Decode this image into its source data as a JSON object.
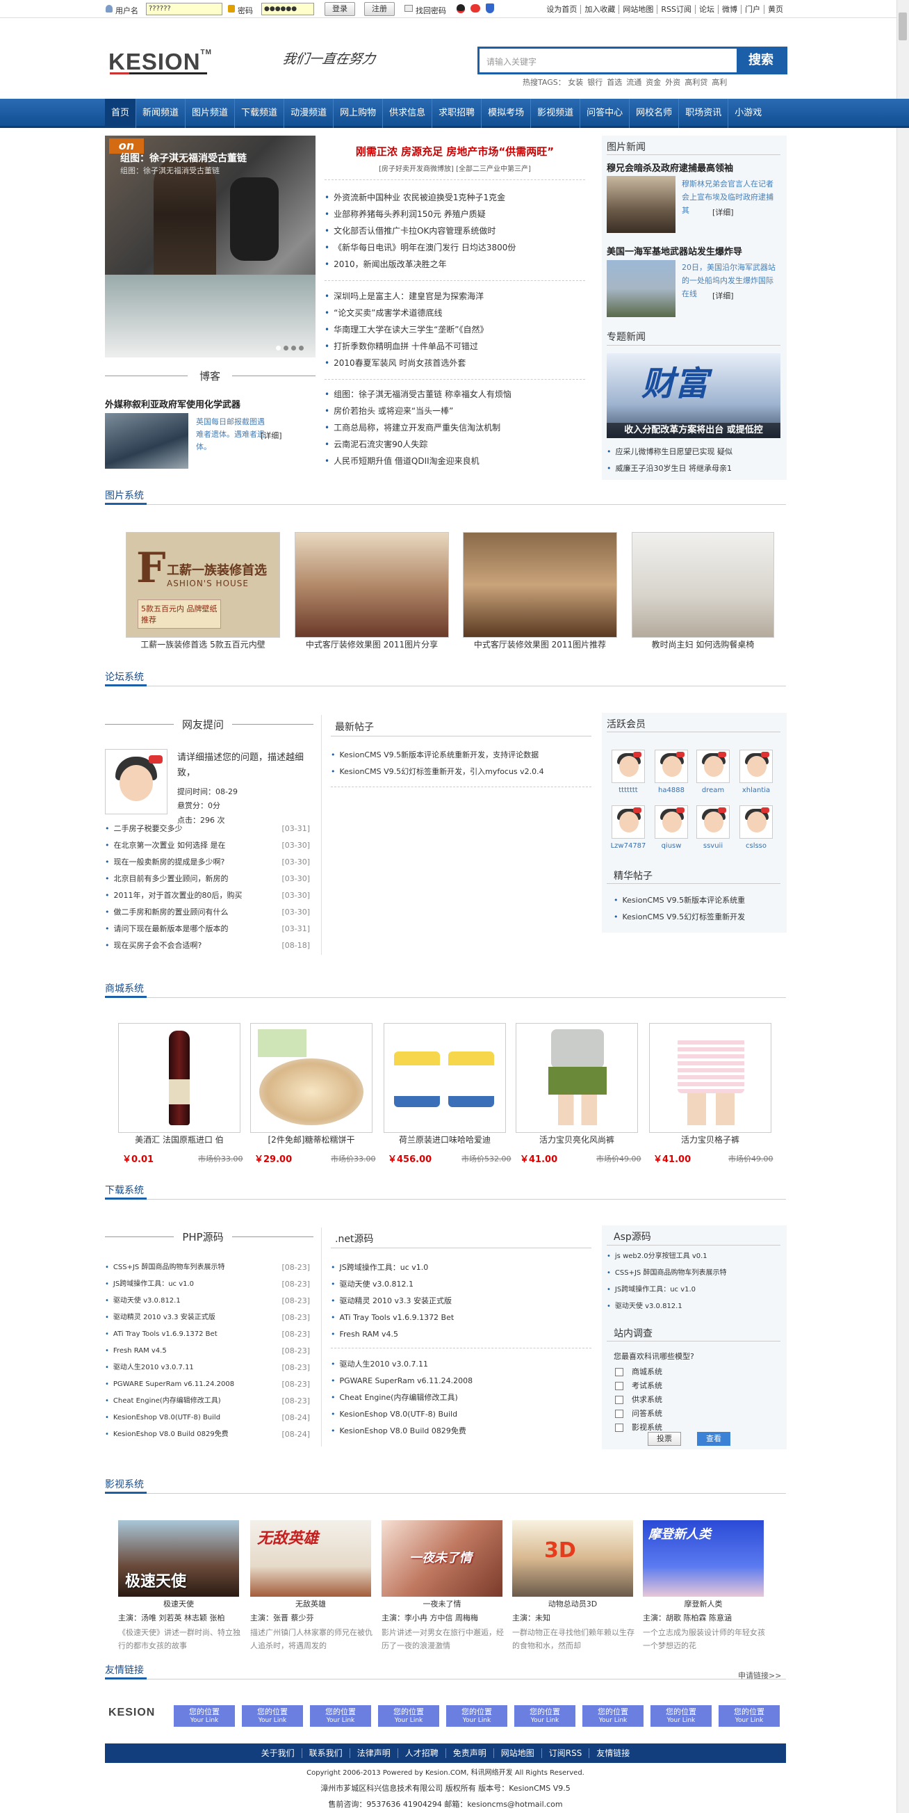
{
  "topbar": {
    "username_label": "用户名",
    "password_label": "密码",
    "username_value": "??????",
    "password_value": "●●●●●●",
    "login_btn": "登录",
    "register_btn": "注册",
    "forgot": "找回密码",
    "links": [
      "设为首页",
      "加入收藏",
      "网站地图",
      "RSS订阅",
      "论坛",
      "微博",
      "门户",
      "黄页"
    ]
  },
  "header": {
    "logo": "KESION",
    "logo_tm": "TM",
    "slogan": "我们一直在努力",
    "search_placeholder": "请输入关键字",
    "search_btn": "搜索",
    "hot_tags_label": "热搜TAGS：",
    "hot_tags": [
      "女装",
      "银行",
      "首选",
      "流通",
      "资金",
      "外资",
      "高利贷",
      "高利"
    ]
  },
  "nav": [
    "首页",
    "新闻频道",
    "图片频道",
    "下载频道",
    "动漫频道",
    "网上购物",
    "供求信息",
    "求职招聘",
    "模拟考场",
    "影视频道",
    "问答中心",
    "网校名师",
    "职场资讯",
    "小游戏"
  ],
  "focus": {
    "badge": "on",
    "caption": "组图：徐子淇无福消受古董链",
    "caption_sub": "组图：徐子淇无福消受古董链"
  },
  "blog": {
    "title": "博客",
    "headline": "外媒称叙利亚政府军使用化学武器",
    "summary": "英国每日邮报截图遇难者遗体。遇难者遗体。",
    "detail": "[详细]"
  },
  "headlines": {
    "main": "刚需正浓 房源充足 房地产市场“供需两旺”",
    "sub": "[房子好卖开发商微博放] [全部二三产业中第三产]",
    "group1": [
      "外资流新中国种业 农民被迫换受1克种子1克金",
      "业部称养猪每头养利润150元 养殖户质疑",
      "文化部否认借推广卡拉OK内容管理系统做时",
      "《新华每日电讯》明年在澳门发行 日均达3800份",
      "2010，新闻出版改革决胜之年"
    ],
    "group2": [
      "深圳吗上是富主人：建皇官是为探索海洋",
      "“论文买卖”成害学术道德底线",
      "华南理工大学在读大三学生“垄断”《自然》",
      "打折季数你精明血拼 十件单品不可错过",
      "2010春夏军装风 时尚女孩首选外套"
    ],
    "group3": [
      "组图：徐子淇无福消受古董链 称幸福女人有烦恼",
      "房价若抬头 或将迎来“当头一棒”",
      "工商总局称，将建立开发商严重失信淘汰机制",
      "云南泥石流灾害90人失踪",
      "人民币短期升值 借道QDII淘金迎来良机"
    ]
  },
  "picnews": {
    "title": "图片新闻",
    "items": [
      {
        "headline": "穆兄会暗杀及政府逮捕最高领袖",
        "text": "穆斯林兄弟会官言人在记者会上宣布埃及临时政府逮捕其",
        "detail": "[详细]"
      },
      {
        "headline": "美国一海军基地武器站发生爆炸导",
        "text": "20日，美国沿尔海军武器站的一处船坞内发生爆炸国际在线",
        "detail": "[详细]"
      }
    ]
  },
  "topicnews": {
    "title": "专题新闻",
    "banner_big": "财富",
    "banner_caption": "收入分配改革方案将出台 或提低控",
    "items": [
      "应采儿微博称生日愿望已实现 疑似",
      "威廉王子沿30岁生日 将继承母亲1"
    ]
  },
  "sections": {
    "pics": "图片系统",
    "forum": "论坛系统",
    "shop": "商城系统",
    "download": "下载系统",
    "movie": "影视系统",
    "friend": "友情链接"
  },
  "pics": [
    {
      "caption": "工薪一族装修首选 5款五百元内壁",
      "banner_line1": "工薪一族装修首选",
      "banner_line2": "ASHION'S HOUSE",
      "banner_line3": "5款五百元内 品牌壁纸推荐"
    },
    {
      "caption": "中式客厅装修效果图 2011图片分享"
    },
    {
      "caption": "中式客厅装修效果图 2011图片推荐"
    },
    {
      "caption": "教时尚主妇 如何选购餐桌椅"
    }
  ],
  "forum": {
    "ask_title": "网友提问",
    "question": "请详细描述您的问题，描述越细致，",
    "ask_time": "提问时间：08-29",
    "reward": "悬赏分：0分",
    "clicks": "点击：296 次",
    "questions": [
      {
        "t": "二手房子税要交多少",
        "d": "[03-31]"
      },
      {
        "t": "在北京第一次置业 如何选择 是在",
        "d": "[03-30]"
      },
      {
        "t": "现在一般卖新房的提成是多少啊?",
        "d": "[03-30]"
      },
      {
        "t": "北京目前有多少置业顾问，新房的",
        "d": "[03-30]"
      },
      {
        "t": "2011年，对于首次置业的80后，购买",
        "d": "[03-30]"
      },
      {
        "t": "做二手房和新房的置业顾问有什么",
        "d": "[03-30]"
      },
      {
        "t": "请问下现在最新版本是哪个版本的",
        "d": "[03-31]"
      },
      {
        "t": "现在买房子会不会合适啊?",
        "d": "[08-18]"
      }
    ],
    "latest_title": "最新帖子",
    "latest": [
      "KesionCMS V9.5新版本评论系统重新开发，支持评论数据",
      "KesionCMS V9.5幻灯标签重新开发，引入myfocus v2.0.4"
    ],
    "active_title": "活跃会员",
    "members": [
      "ttttttt",
      "ha4888",
      "dream",
      "xhlantia",
      "Lzw74787",
      "qiusw",
      "ssvuii",
      "cslsso"
    ],
    "best_title": "精华帖子",
    "best": [
      "KesionCMS V9.5新版本评论系统重",
      "KesionCMS V9.5幻灯标签重新开发"
    ]
  },
  "shop": [
    {
      "name": "美酒汇 法国原瓶进口 伯",
      "price": "￥0.01",
      "old": "市场价33.00"
    },
    {
      "name": "[2件免邮]糖蒂松糯饼干",
      "price": "￥29.00",
      "old": "市场价33.00"
    },
    {
      "name": "荷兰原装进口味哈哈爱迪",
      "price": "￥456.00",
      "old": "市场价532.00"
    },
    {
      "name": "活力宝贝亮化风尚裤",
      "price": "￥41.00",
      "old": "市场价49.00"
    },
    {
      "name": "活力宝贝格子裤",
      "price": "￥41.00",
      "old": "市场价49.00"
    }
  ],
  "download": {
    "php_title": "PHP源码",
    "php": [
      {
        "t": "CSS+JS 醉国商品购物车列表展示特",
        "d": "[08-23]"
      },
      {
        "t": "JS跨域操作工具：uc v1.0",
        "d": "[08-23]"
      },
      {
        "t": "驱动天使 v3.0.812.1",
        "d": "[08-23]"
      },
      {
        "t": "驱动精灵 2010 v3.3 安装正式版",
        "d": "[08-23]"
      },
      {
        "t": "ATi Tray Tools v1.6.9.1372 Bet",
        "d": "[08-23]"
      },
      {
        "t": "Fresh RAM v4.5",
        "d": "[08-23]"
      },
      {
        "t": "驱动人生2010 v3.0.7.11",
        "d": "[08-23]"
      },
      {
        "t": "PGWARE SuperRam v6.11.24.2008",
        "d": "[08-23]"
      },
      {
        "t": "Cheat Engine(内存编辑修改工具)",
        "d": "[08-23]"
      },
      {
        "t": "KesionEshop V8.0(UTF-8) Build",
        "d": "[08-24]"
      },
      {
        "t": "KesionEshop V8.0 Build 0829免费",
        "d": "[08-24]"
      }
    ],
    "net_title": ".net源码",
    "net1": [
      "JS跨域操作工具：uc v1.0",
      "驱动天使 v3.0.812.1",
      "驱动精灵 2010 v3.3 安装正式版",
      "ATi Tray Tools v1.6.9.1372 Bet",
      "Fresh RAM v4.5"
    ],
    "net2": [
      "驱动人生2010 v3.0.7.11",
      "PGWARE SuperRam v6.11.24.2008",
      "Cheat Engine(内存编辑修改工具)",
      "KesionEshop V8.0(UTF-8) Build",
      "KesionEshop V8.0 Build 0829免费"
    ],
    "asp_title": "Asp源码",
    "asp": [
      "js web2.0分享按钮工具 v0.1",
      "CSS+JS 醉国商品购物车列表展示特",
      "JS跨域操作工具：uc v1.0",
      "驱动天使 v3.0.812.1"
    ],
    "survey_title": "站内调查",
    "survey_q": "您最喜欢科讯哪些模型?",
    "survey_options": [
      "商城系统",
      "考试系统",
      "供求系统",
      "问答系统",
      "影视系统"
    ],
    "vote_btn": "投票",
    "view_btn": "查看"
  },
  "movies": [
    {
      "title": "极速天使",
      "cast": "主演：汤唯 刘若英 林志颖 张柏",
      "desc": "《极速天使》讲述一群时尚、特立独行的都市女孩的故事",
      "poster": "极速天使"
    },
    {
      "title": "无敌英雄",
      "cast": "主演：张晋 蔡少芬",
      "desc": "描述广州镇门人林家寨的师兄在被仇人追杀时，将遇周发的",
      "poster": "无敌英雄"
    },
    {
      "title": "一夜未了情",
      "cast": "主演：李小冉 方中信 周梅梅",
      "desc": "影片讲述一对男女在旅行中邂逅，经历了一夜的浪漫激情",
      "poster": "一夜未了情"
    },
    {
      "title": "动物总动员3D",
      "cast": "主演：未知",
      "desc": "一群动物正在寻找他们赖年赖以生存的食物和水，然而却",
      "poster": "3D"
    },
    {
      "title": "摩登新人类",
      "cast": "主演：胡歌 陈柏霖 陈意涵",
      "desc": "一个立志成为服装设计师的年轻女孩一个梦想迈的花",
      "poster": "摩登新人类"
    }
  ],
  "friend": {
    "apply": "申请链接>>",
    "logo": "KESION",
    "tile_l1": "您的位置",
    "tile_l2": "Your Link",
    "count": 9
  },
  "footer": {
    "nav": [
      "关于我们",
      "联系我们",
      "法律声明",
      "人才招聘",
      "免责声明",
      "网站地图",
      "订阅RSS",
      "友情链接"
    ],
    "line1": "Copyright 2006-2013 Powered by Kesion.COM, 科讯网络开发 All Rights Reserved.",
    "line2": "漳州市芗城区科兴信息技术有限公司 版权所有 版本号：KesionCMS V9.5",
    "line3": "售前咨询：9537636 41904294 邮箱：kesioncms@hotmail.com"
  },
  "colors": {
    "nav_blue": "#1a5fa8",
    "price_red": "#d00000",
    "link_blue": "#6b7fe0",
    "headline_red": "#c00000"
  }
}
